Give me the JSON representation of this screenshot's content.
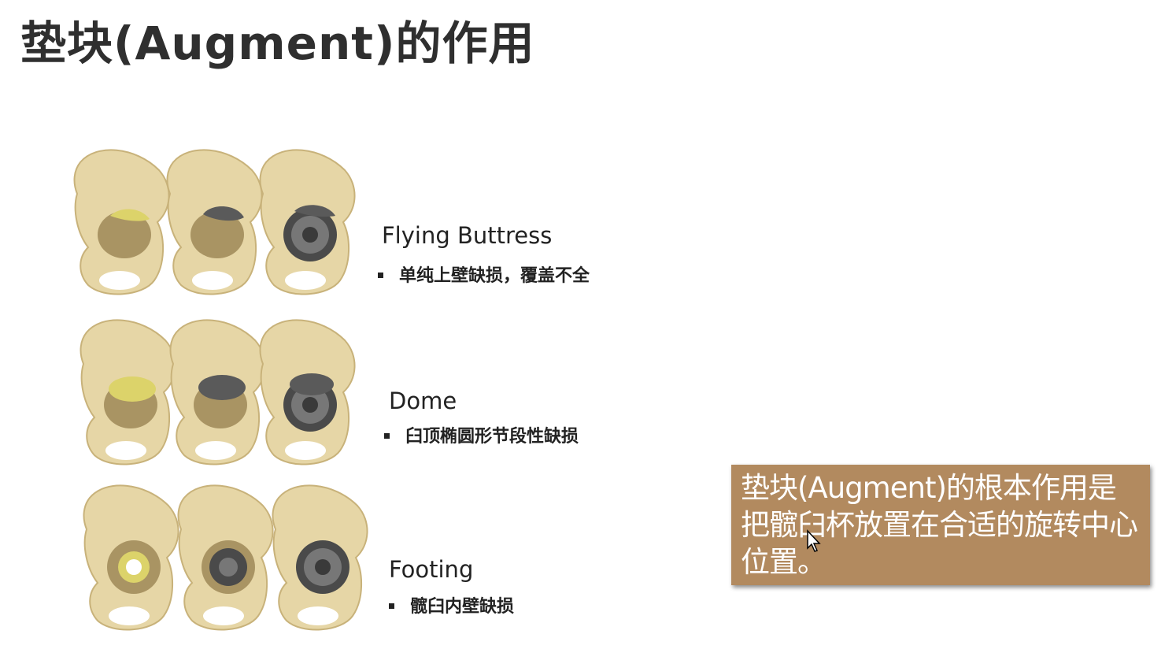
{
  "slide": {
    "title": "垫块(Augment)的作用",
    "sections": [
      {
        "label": "Flying Buttress",
        "bullet": "单纯上壁缺损，覆盖不全",
        "defect": "flying-buttress"
      },
      {
        "label": "Dome",
        "bullet": "臼顶椭圆形节段性缺损",
        "defect": "dome"
      },
      {
        "label": "Footing",
        "bullet": "髋臼内壁缺损",
        "defect": "footing"
      }
    ],
    "callout": {
      "text": "垫块(Augment)的根本作用是把髋臼杯放置在合适的旋转中心位置。"
    }
  },
  "colors": {
    "bone": "#e6d6a6",
    "bone_shadow": "#c8b27a",
    "defect_yellow": "#dcd36a",
    "metal": "#5a5a5a",
    "callout_bg": "#b28a5f",
    "title": "#2f2f2f"
  },
  "icons": {
    "cursor": "mouse-pointer-icon"
  }
}
